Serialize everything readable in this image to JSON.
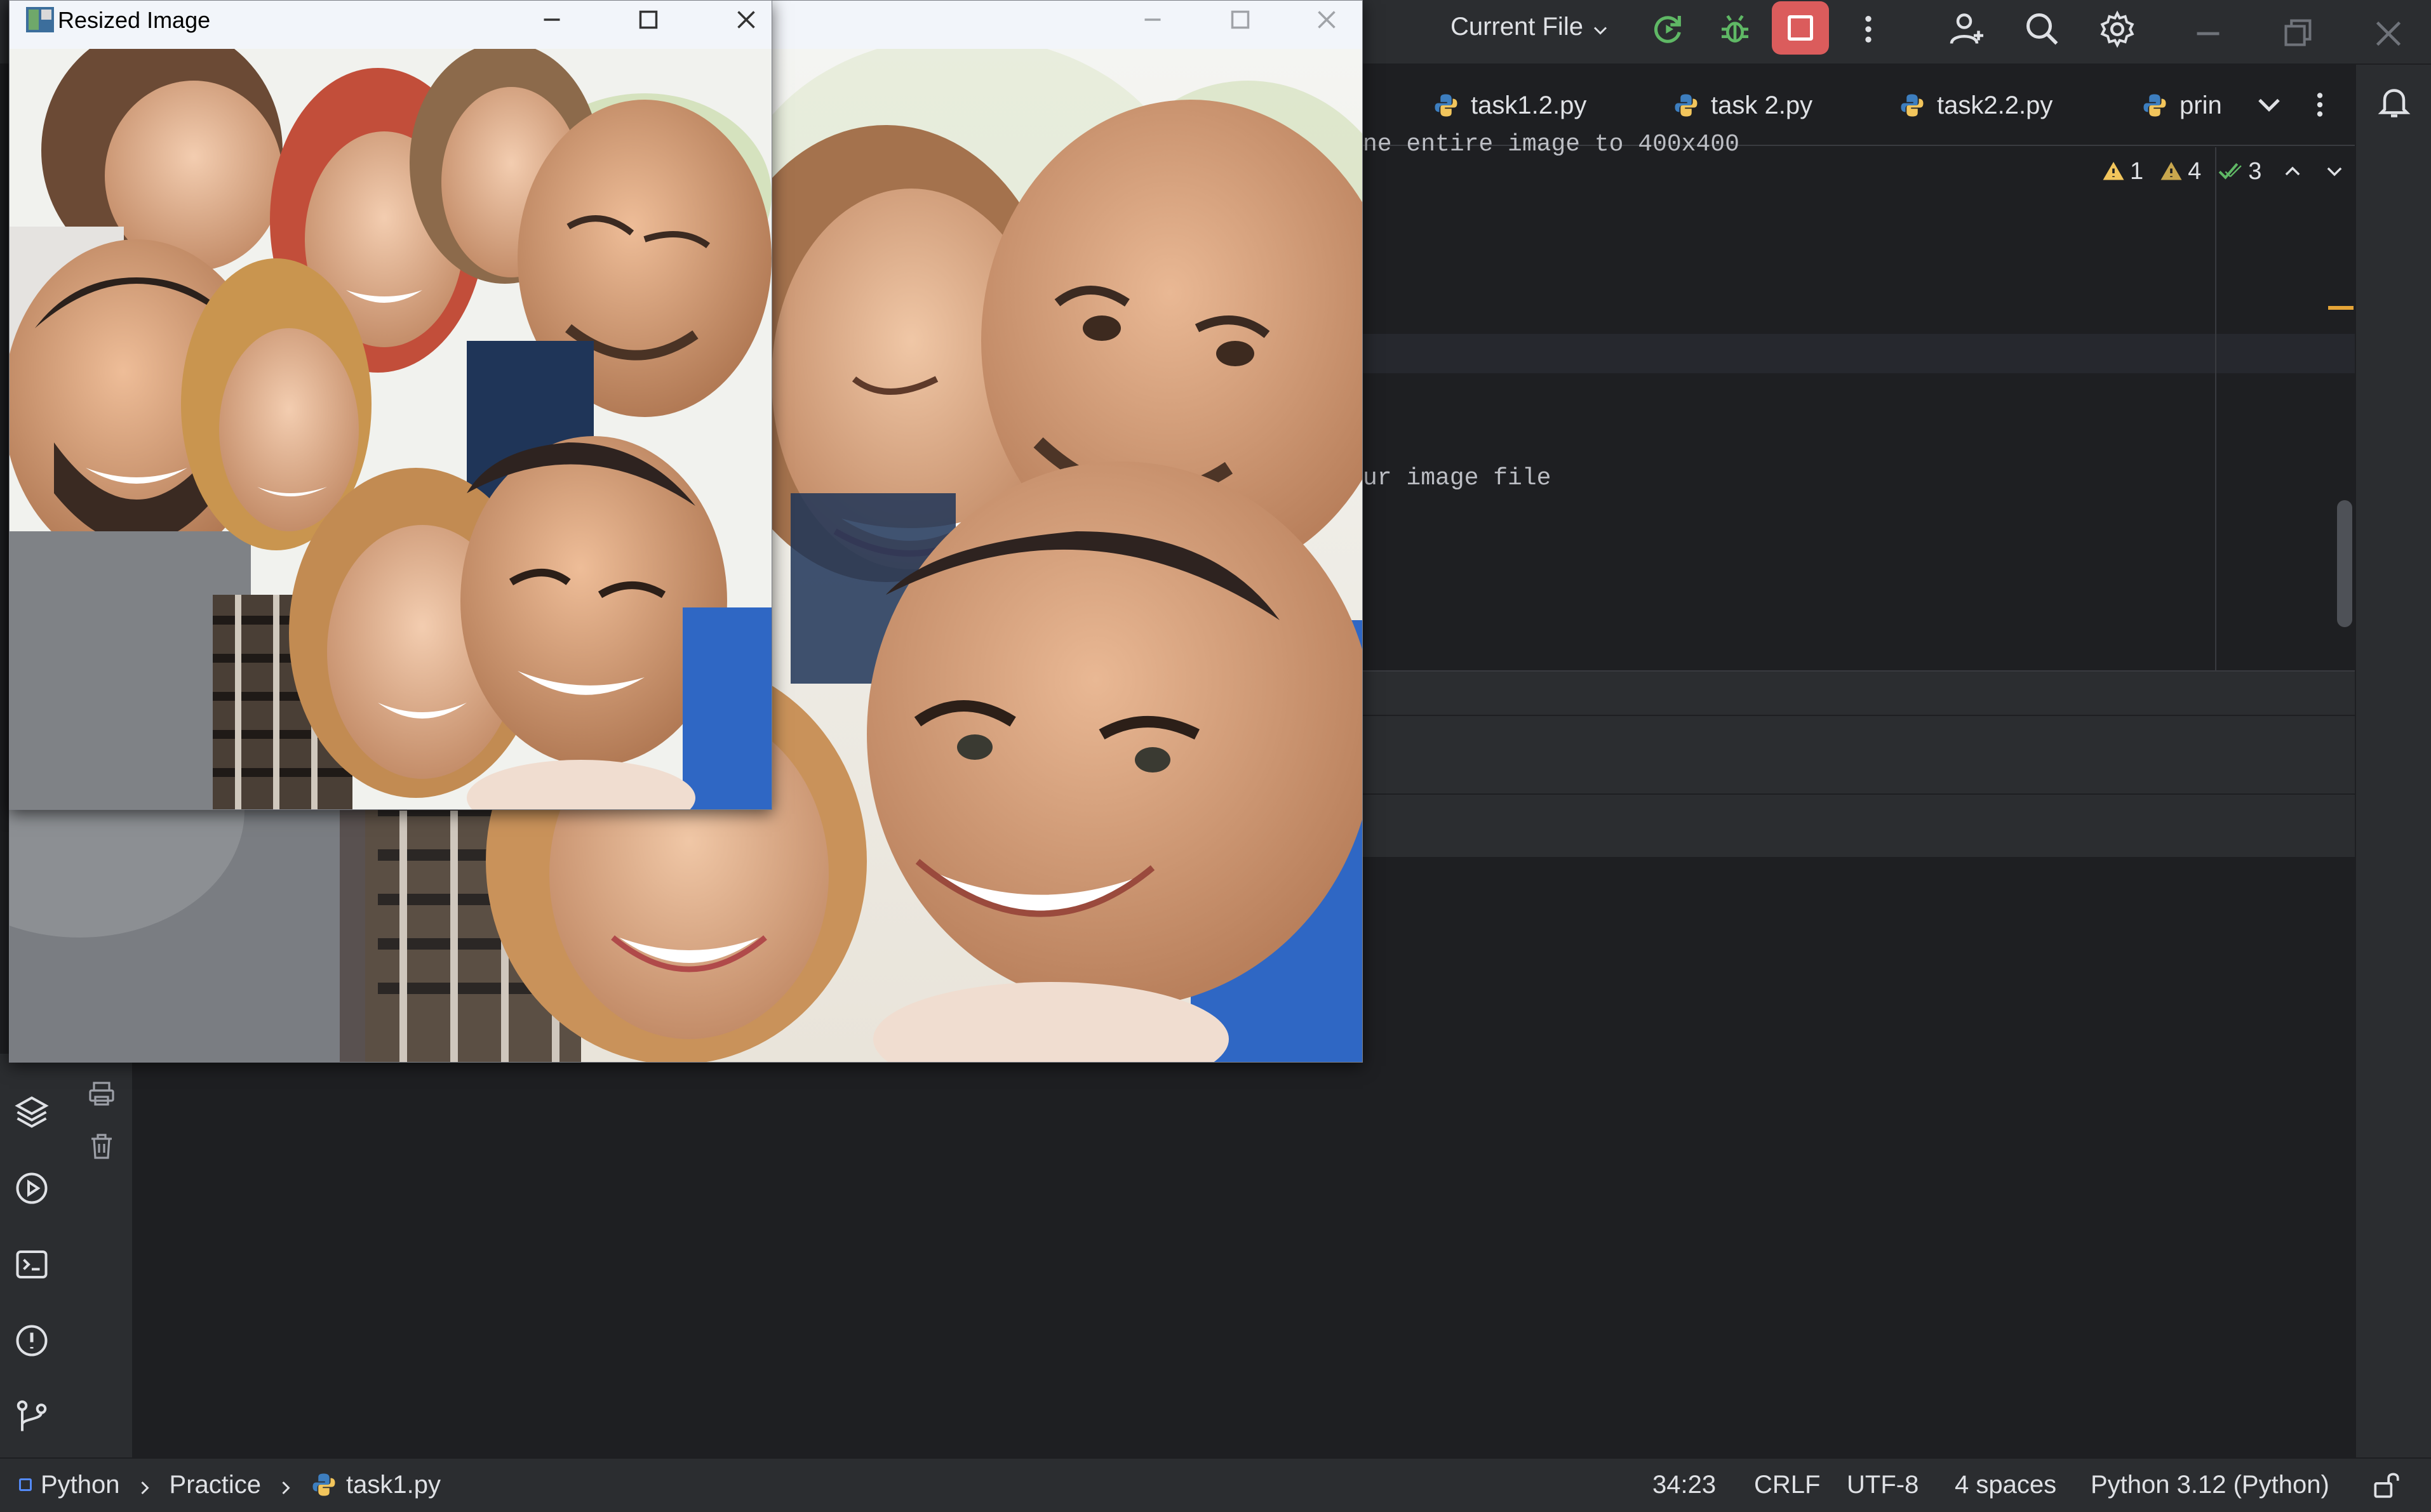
{
  "ide": {
    "run_config": "Current File",
    "tabs": [
      {
        "label": "task1.2.py"
      },
      {
        "label": "task 2.py"
      },
      {
        "label": "task2.2.py"
      },
      {
        "label": "prin"
      }
    ],
    "inspections": {
      "warnings_a": "1",
      "warnings_b": "4",
      "ok": "3"
    },
    "code_lines": [
      "ne entire image to 400x400",
      "ur image file"
    ]
  },
  "windows": {
    "front_title": "Resized Image"
  },
  "status": {
    "breadcrumbs": [
      "Python",
      "Practice",
      "task1.py"
    ],
    "position": "34:23",
    "line_sep": "CRLF",
    "encoding": "UTF-8",
    "indent": "4 spaces",
    "interpreter": "Python 3.12 (Python)"
  },
  "colors": {
    "ide_bg": "#1e1f22",
    "ide_panel": "#2b2d30",
    "stop_button": "#db5c5c",
    "run_green": "#5fb865",
    "warning": "#f2c55c"
  },
  "icons": {
    "run": "rerun-icon",
    "debug": "debug-icon",
    "stop": "stop-icon",
    "more": "more-vertical-icon",
    "add_user": "add-user-icon",
    "search": "search-icon",
    "settings": "gear-icon",
    "notifications": "bell-icon"
  }
}
